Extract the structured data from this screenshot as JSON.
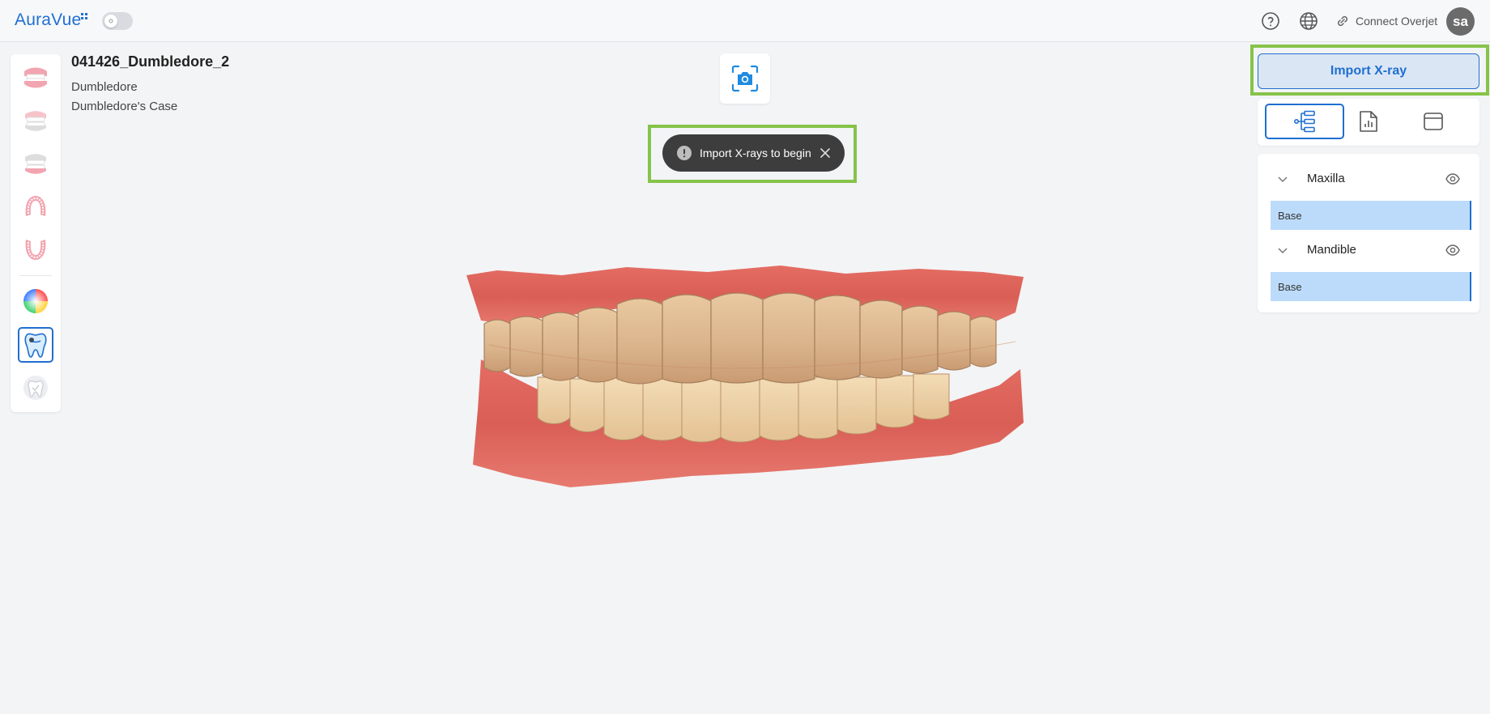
{
  "app": {
    "brand": "AuraVue",
    "theme_toggle": "light"
  },
  "header": {
    "icons": [
      "help-icon",
      "globe-icon"
    ],
    "connect_label": "Connect Overjet",
    "avatar_initials": "sa"
  },
  "case": {
    "title": "041426_Dumbledore_2",
    "patient": "Dumbledore",
    "case_name": "Dumbledore's Case"
  },
  "left_tools": [
    {
      "icon": "full-arch-teeth-icon",
      "active": false
    },
    {
      "icon": "both-arches-teeth-icon",
      "active": false
    },
    {
      "icon": "occlusion-teeth-icon",
      "active": false
    },
    {
      "icon": "upper-arch-icon",
      "active": false
    },
    {
      "icon": "lower-arch-icon",
      "active": false
    },
    {
      "icon": "color-wheel-icon",
      "active": false
    },
    {
      "icon": "xray-tooth-icon",
      "active": true
    },
    {
      "icon": "tooth-check-icon",
      "active": false
    }
  ],
  "toast": {
    "message": "Import X-rays to begin"
  },
  "right_panel": {
    "import_button": "Import X-ray",
    "view_tabs": [
      {
        "icon": "tree-structure-icon",
        "active": true
      },
      {
        "icon": "report-document-icon",
        "active": false
      },
      {
        "icon": "panel-layout-icon",
        "active": false
      }
    ],
    "layers": [
      {
        "name": "Maxilla",
        "base": "Base"
      },
      {
        "name": "Mandible",
        "base": "Base"
      }
    ]
  },
  "colors": {
    "accent": "#1f6fd1",
    "highlight": "#86c34a",
    "toast_bg": "#3d3d3d",
    "layer_base_bg": "#bcdbfa"
  }
}
